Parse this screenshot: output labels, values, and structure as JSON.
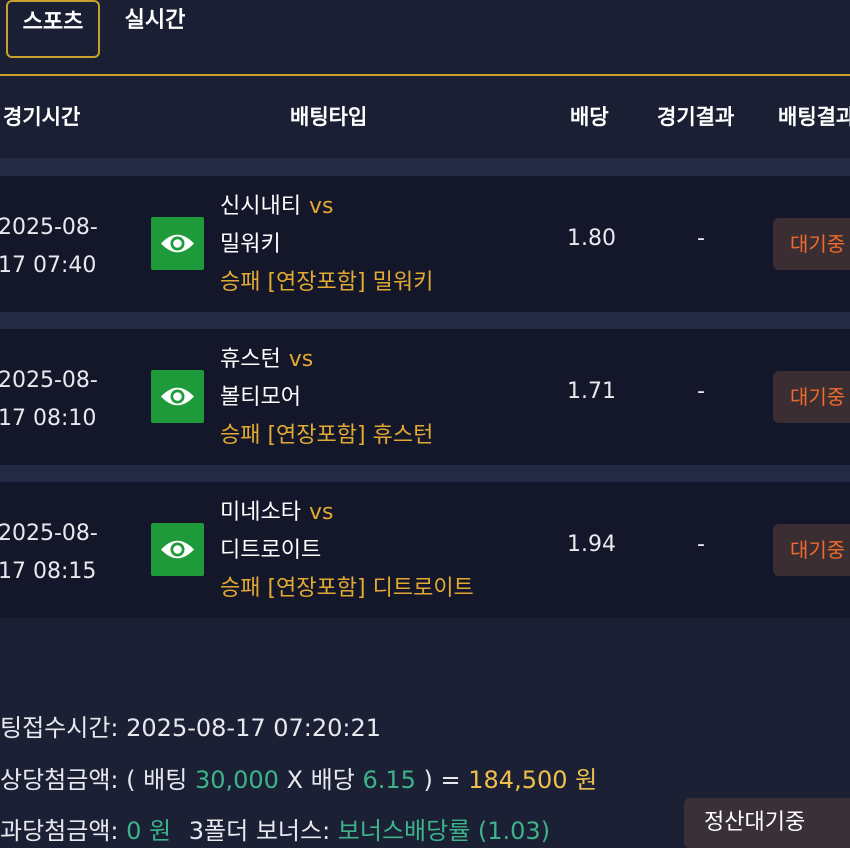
{
  "tabs": {
    "sports": "스포츠",
    "live": "실시간"
  },
  "header": {
    "time": "경기시간",
    "bet_type": "배팅타입",
    "odds": "배당",
    "game_result": "경기결과",
    "bet_result": "배팅결과"
  },
  "vs_label": "vs",
  "rows": [
    {
      "date": "2025-08-",
      "time": "17 07:40",
      "team1": "신시내티",
      "team2": "밀워키",
      "pick": "승패 [연장포함] 밀워키",
      "odds": "1.80",
      "result": "-",
      "status": "대기중"
    },
    {
      "date": "2025-08-",
      "time": "17 08:10",
      "team1": "휴스턴",
      "team2": "볼티모어",
      "pick": "승패 [연장포함] 휴스턴",
      "odds": "1.71",
      "result": "-",
      "status": "대기중"
    },
    {
      "date": "2025-08-",
      "time": "17 08:15",
      "team1": "미네소타",
      "team2": "디트로이트",
      "pick": "승패 [연장포함] 디트로이트",
      "odds": "1.94",
      "result": "-",
      "status": "대기중"
    }
  ],
  "summary": {
    "accept_time_label": "팅접수시간:",
    "accept_time": "2025-08-17 07:20:21",
    "expected_label": "상당첨금액:",
    "bet_open": "( 배팅",
    "bet_amount": "30,000",
    "times": "X 배당",
    "total_odds": "6.15",
    "equals": ") =",
    "payout": "184,500 원",
    "actual_label": "과당첨금액:",
    "actual_amount": "0 원",
    "bonus_label": "3폴더 보너스:",
    "bonus_value": "보너스배당률 (1.03)",
    "settle_button": "정산대기중"
  },
  "colors": {
    "accent": "#c7a02e",
    "pick": "#e2a933",
    "green": "#3cb38a",
    "status": "#ef6a2c"
  },
  "icons": {
    "view": "eye-icon"
  }
}
